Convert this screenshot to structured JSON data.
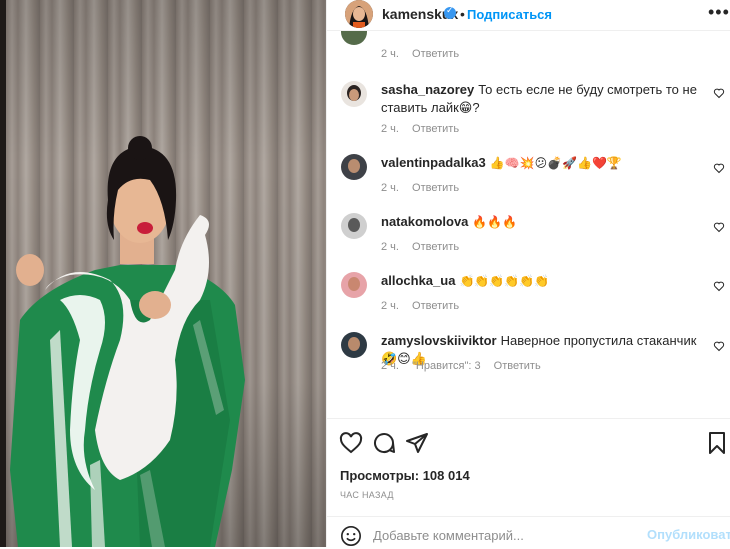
{
  "post": {
    "username": "kamenskux",
    "follow_label": "Подписаться",
    "separator": "•",
    "more_label": "•••"
  },
  "comments": [
    {
      "user": "",
      "text": "",
      "time": "2 ч.",
      "likes": "",
      "reply": "Ответить"
    },
    {
      "user": "sasha_nazorey",
      "text": "То есть есле не буду смотреть то не ставить лайк😁?",
      "time": "2 ч.",
      "likes": "",
      "reply": "Ответить"
    },
    {
      "user": "valentinpadalka3",
      "text": "👍🧠💥😕💣🚀👍❤️🏆",
      "time": "2 ч.",
      "likes": "",
      "reply": "Ответить"
    },
    {
      "user": "natakomolova",
      "text": "🔥🔥🔥",
      "time": "2 ч.",
      "likes": "",
      "reply": "Ответить"
    },
    {
      "user": "allochka_ua",
      "text": "👏👏👏👏👏👏",
      "time": "2 ч.",
      "likes": "",
      "reply": "Ответить"
    },
    {
      "user": "zamyslovskiiviktor",
      "text": "Наверное пропустила стаканчик 🤣😊👍",
      "time": "2 ч.",
      "likes": "\"Нравится\": 3",
      "reply": "Ответить"
    }
  ],
  "actions": {
    "views": "Просмотры: 108 014",
    "timestamp": "ЧАС НАЗАД"
  },
  "compose": {
    "placeholder": "Добавьте комментарий...",
    "publish_label": "Опубликовать"
  },
  "icons": {
    "like": "heart-icon",
    "comment": "comment-icon",
    "share": "share-icon",
    "save": "bookmark-icon",
    "emoji": "smile-icon",
    "more": "more-icon",
    "verified": "verified-icon"
  },
  "colors": {
    "accent": "#0095f6",
    "publish_disabled": "#b2dffc",
    "muted": "#8e8e8e",
    "verified": "#3897f0"
  }
}
